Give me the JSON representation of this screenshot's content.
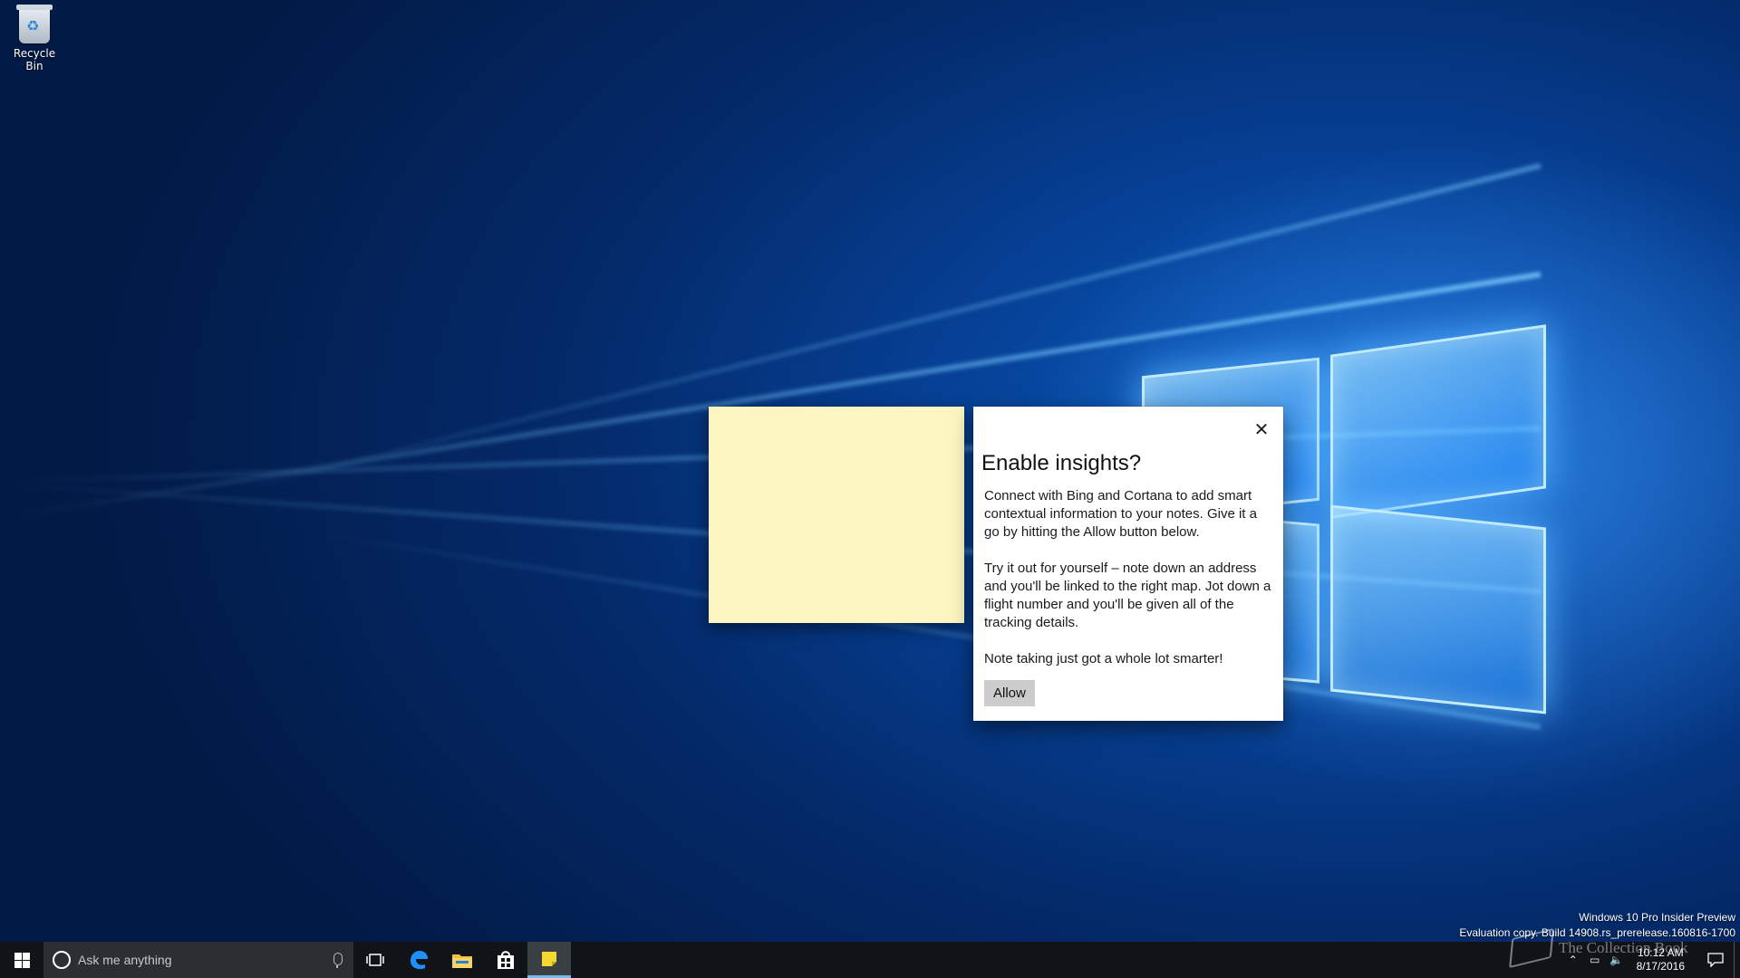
{
  "desktop": {
    "recycle_bin_label": "Recycle Bin"
  },
  "dialog": {
    "title": "Enable insights?",
    "paragraphs": [
      "Connect with Bing and Cortana to add smart contextual information to your notes. Give it a go by hitting the Allow button below.",
      "Try it out for yourself – note down an address and you'll be linked to the right map. Jot down a flight number and you'll be given all of the tracking details.",
      "Note taking just got a whole lot smarter!"
    ],
    "allow_label": "Allow",
    "close_glyph": "✕"
  },
  "sticky_note": {
    "color": "#fcf7c2"
  },
  "watermark": {
    "line1": "Windows 10 Pro Insider Preview",
    "line2": "Evaluation copy. Build 14908.rs_prerelease.160816-1700"
  },
  "site_logo": {
    "text": "The Collection Book"
  },
  "taskbar": {
    "search_placeholder": "Ask me anything",
    "apps": [
      {
        "name": "task-view",
        "icon": "task-view-icon"
      },
      {
        "name": "edge",
        "icon": "edge-icon"
      },
      {
        "name": "file-explorer",
        "icon": "folder-icon"
      },
      {
        "name": "store",
        "icon": "store-icon"
      },
      {
        "name": "sticky-notes",
        "icon": "sticky-notes-icon",
        "active": true
      }
    ],
    "clock": {
      "time": "10:12 AM",
      "date": "8/17/2016"
    }
  },
  "colors": {
    "accent": "#76b9ed",
    "taskbar": "#101418",
    "desktop_blue": "#063f93"
  }
}
